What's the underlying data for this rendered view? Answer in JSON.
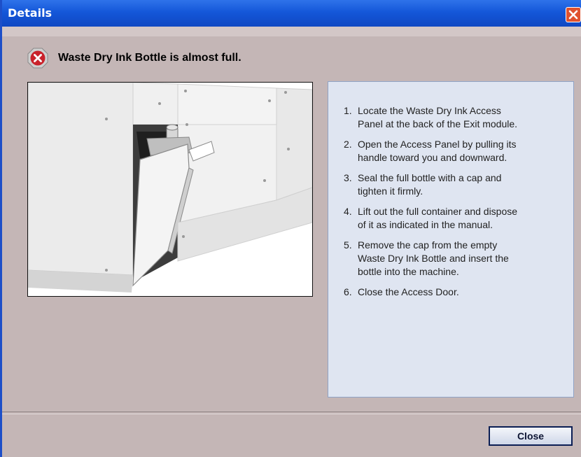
{
  "window": {
    "title": "Details",
    "accent_color": "#1457d9",
    "close_icon": "close-icon"
  },
  "header": {
    "icon": "error-icon",
    "icon_color": "#c9222b",
    "message": "Waste Dry Ink Bottle is almost full."
  },
  "illustration": {
    "icon": "printer-access-panel-illustration"
  },
  "steps": [
    {
      "number": "1.",
      "text": "Locate the Waste Dry Ink Access Panel at the back of the Exit module."
    },
    {
      "number": "2.",
      "text": "Open the Access Panel by pulling its handle toward you and downward."
    },
    {
      "number": "3.",
      "text": "Seal the full bottle with a cap and tighten it firmly."
    },
    {
      "number": "4.",
      "text": "Lift out the full container and dispose of it as indicated in the manual."
    },
    {
      "number": "5.",
      "text": "Remove the cap from the empty Waste Dry Ink Bottle and insert the bottle into the machine."
    },
    {
      "number": "6.",
      "text": "Close the Access Door."
    }
  ],
  "footer": {
    "close_label": "Close"
  }
}
